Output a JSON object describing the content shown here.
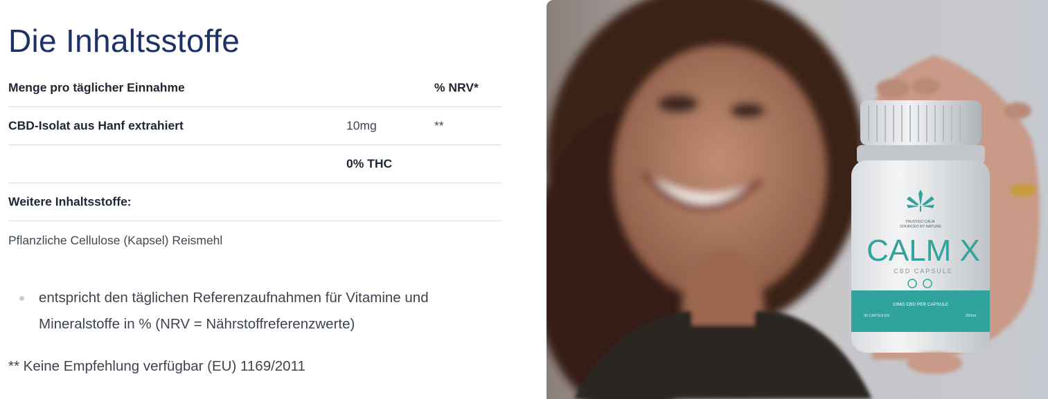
{
  "title": "Die Inhaltsstoffe",
  "table": {
    "header": {
      "name": "Menge pro täglicher Einnahme",
      "amount": "",
      "nrv": "% NRV*"
    },
    "rows": [
      {
        "name": "CBD-Isolat aus Hanf extrahiert",
        "amount": "10mg",
        "nrv": "**"
      },
      {
        "name": "",
        "amount": "0% THC",
        "nrv": ""
      }
    ],
    "further_heading": "Weitere Inhaltsstoffe:",
    "further_value": "Pflanzliche Cellulose (Kapsel) Reismehl"
  },
  "bullets": [
    "entspricht den täglichen Referenzaufnahmen für Vitamine und Mineralstoffe in % (NRV = Nährstoffreferenzwerte)"
  ],
  "footnote": "** Keine Empfehlung verfügbar (EU) 1169/2011",
  "product": {
    "brand_small": "TRUSTED CALM\nSOURCED BY NATURE",
    "name": "CALM X",
    "subtitle": "CBD CAPSULE",
    "band_text": "10MG CBD PER CAPSULE",
    "count": "30 CAPSULES",
    "volume": "250ml"
  },
  "colors": {
    "title": "#1d3166",
    "teal": "#2fa39c",
    "divider": "#d9dde2"
  }
}
